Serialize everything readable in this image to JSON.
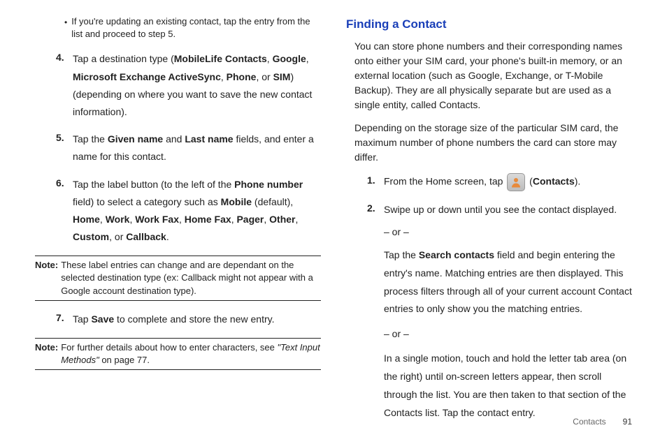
{
  "left": {
    "bullet": "If you're updating an existing contact, tap the entry from the list and proceed to step 5.",
    "step4_a": "Tap a destination type (",
    "step4_b1": "MobileLife Contacts",
    "step4_c1": ", ",
    "step4_b2": "Google",
    "step4_c2": ", ",
    "step4_b3": "Microsoft Exchange ActiveSync",
    "step4_c3": ", ",
    "step4_b4": "Phone",
    "step4_c4": ", or ",
    "step4_b5": "SIM",
    "step4_d": ") (depending on where you want to save the new contact information).",
    "step5_a": "Tap the ",
    "step5_b1": "Given name",
    "step5_c": " and ",
    "step5_b2": "Last name",
    "step5_d": " fields, and enter a name for this contact.",
    "step6_a": "Tap the label button (to the left of the ",
    "step6_b1": "Phone number",
    "step6_c": " field) to select a category such as ",
    "step6_b2": "Mobile",
    "step6_d": " (default), ",
    "step6_b3": "Home",
    "step6_e": ", ",
    "step6_b4": "Work",
    "step6_f": ", ",
    "step6_b5": "Work Fax",
    "step6_g": ", ",
    "step6_b6": "Home Fax",
    "step6_h": ", ",
    "step6_b7": "Pager",
    "step6_i": ", ",
    "step6_b8": "Other",
    "step6_j": ", ",
    "step6_b9": "Custom",
    "step6_k": ", or ",
    "step6_b10": "Callback",
    "step6_l": ".",
    "note1": "These label entries can change and are dependant on the selected destination type (ex: Callback might not appear with a Google account destination type).",
    "step7_a": "Tap ",
    "step7_b": "Save",
    "step7_c": " to complete and store the new entry.",
    "note2_a": "For further details about how to enter characters, see ",
    "note2_i": "\"Text Input Methods\"",
    "note2_b": " on page 77.",
    "num4": "4.",
    "num5": "5.",
    "num6": "6.",
    "num7": "7.",
    "noteL": "Note:"
  },
  "right": {
    "heading": "Finding a Contact",
    "para1": "You can store phone numbers and their corresponding names onto either your SIM card, your phone's built-in memory, or an external location (such as Google, Exchange, or T-Mobile Backup). They are all physically separate but are used as a single entity, called Contacts.",
    "para2": "Depending on the storage size of the particular SIM card, the maximum number of phone numbers the card can store may differ.",
    "num1": "1.",
    "num2": "2.",
    "step1_a": "From the Home screen, tap ",
    "step1_b": " (",
    "step1_c": "Contacts",
    "step1_d": ").",
    "step2_a": "Swipe up or down until you see the contact displayed.",
    "or": "– or –",
    "step2_b_a": "Tap the ",
    "step2_b_b": "Search contacts",
    "step2_b_c": " field and begin entering the entry's name. Matching entries are then displayed. This process filters through all of your current account Contact entries to only show you the matching entries.",
    "step2_c": "In a single motion, touch and hold the letter tab area (on the right) until on-screen letters appear, then scroll through the list. You are then taken to that section of the Contacts list. Tap the contact entry."
  },
  "footer": {
    "section": "Contacts",
    "page": "91"
  }
}
